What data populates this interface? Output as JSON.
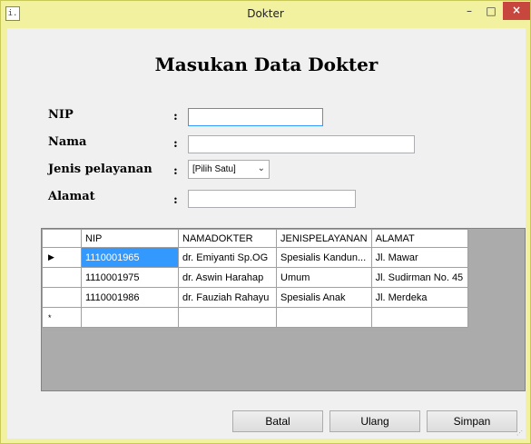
{
  "window": {
    "title": "Dokter",
    "icon": "app-icon",
    "minimize_glyph": "–",
    "maximize_glyph": "□",
    "close_glyph": "×"
  },
  "form": {
    "heading": "Masukan Data Dokter",
    "colon": ":",
    "fields": {
      "nip": {
        "label": "NIP",
        "value": ""
      },
      "nama": {
        "label": "Nama",
        "value": ""
      },
      "jenis": {
        "label": "Jenis pelayanan",
        "selected": "[Pilih Satu]"
      },
      "alamat": {
        "label": "Alamat",
        "value": ""
      }
    }
  },
  "grid": {
    "columns": [
      "NIP",
      "NAMADOKTER",
      "JENISPELAYANAN",
      "ALAMAT"
    ],
    "current_row_glyph": "▶",
    "new_row_glyph": "*",
    "rows": [
      [
        "1110001965",
        "dr. Emiyanti Sp.OG",
        "Spesialis Kandun...",
        "Jl. Mawar"
      ],
      [
        "1110001975",
        "dr. Aswin Harahap",
        "Umum",
        "Jl. Sudirman No. 45"
      ],
      [
        "1110001986",
        "dr. Fauziah Rahayu",
        "Spesialis Anak",
        "Jl. Merdeka"
      ]
    ]
  },
  "buttons": {
    "batal": "Batal",
    "ulang": "Ulang",
    "simpan": "Simpan"
  },
  "colors": {
    "titlebar": "#f1f1a0",
    "close": "#c7463e",
    "selection": "#3399ff"
  }
}
